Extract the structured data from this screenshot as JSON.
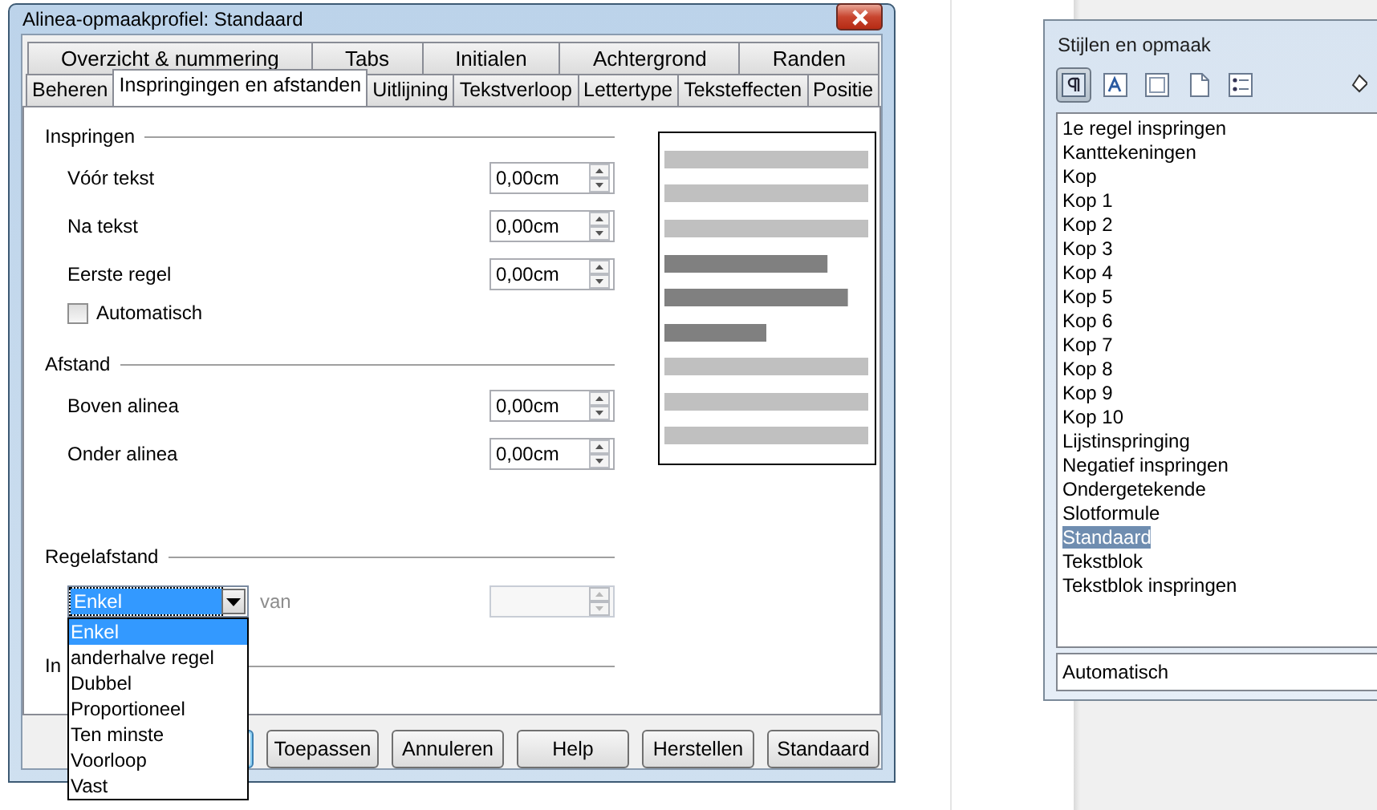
{
  "window": {
    "title": "Alinea-opmaakprofiel: Standaard"
  },
  "tab_rows": [
    [
      {
        "label": "Overzicht & nummering",
        "selected": false
      },
      {
        "label": "Tabs",
        "selected": false
      },
      {
        "label": "Initialen",
        "selected": false
      },
      {
        "label": "Achtergrond",
        "selected": false
      },
      {
        "label": "Randen",
        "selected": false
      }
    ],
    [
      {
        "label": "Beheren",
        "selected": false
      },
      {
        "label": "Inspringingen en afstanden",
        "selected": true
      },
      {
        "label": "Uitlijning",
        "selected": false
      },
      {
        "label": "Tekstverloop",
        "selected": false
      },
      {
        "label": "Lettertype",
        "selected": false
      },
      {
        "label": "Teksteffecten",
        "selected": false
      },
      {
        "label": "Positie",
        "selected": false
      }
    ]
  ],
  "sections": [
    {
      "title": "Inspringen",
      "rows": [
        {
          "kind": "spin",
          "label": "Vóór tekst",
          "value": "0,00cm"
        },
        {
          "kind": "spin",
          "label": "Na tekst",
          "value": "0,00cm"
        },
        {
          "kind": "spin",
          "label": "Eerste regel",
          "value": "0,00cm"
        },
        {
          "kind": "checkbox",
          "label": "Automatisch",
          "checked": false
        }
      ]
    },
    {
      "title": "Afstand",
      "rows": [
        {
          "kind": "spin",
          "label": "Boven alinea",
          "value": "0,00cm"
        },
        {
          "kind": "spin",
          "label": "Onder alinea",
          "value": "0,00cm"
        }
      ]
    },
    {
      "title": "Regelafstand",
      "rows": [
        {
          "kind": "combo",
          "value": "Enkel",
          "expanded": true,
          "unit_label": "van",
          "disabled": true,
          "options": [
            {
              "label": "Enkel",
              "selected": true
            },
            {
              "label": "anderhalve regel",
              "selected": false
            },
            {
              "label": "Dubbel",
              "selected": false
            },
            {
              "label": "Proportioneel",
              "selected": false
            },
            {
              "label": "Ten minste",
              "selected": false
            },
            {
              "label": "Voorloop",
              "selected": false
            },
            {
              "label": "Vast",
              "selected": false
            }
          ]
        }
      ]
    },
    {
      "title": "In"
    }
  ],
  "buttons": [
    {
      "label": "Toepassen"
    },
    {
      "label": "Annuleren"
    },
    {
      "label": "Help"
    },
    {
      "label": "Herstellen"
    },
    {
      "label": "Standaard"
    }
  ],
  "styles_panel": {
    "title": "Stijlen en opmaak",
    "items": [
      {
        "label": "1e regel inspringen",
        "selected": false
      },
      {
        "label": "Kanttekeningen",
        "selected": false
      },
      {
        "label": "Kop",
        "selected": false
      },
      {
        "label": "Kop 1",
        "selected": false
      },
      {
        "label": "Kop 2",
        "selected": false
      },
      {
        "label": "Kop 3",
        "selected": false
      },
      {
        "label": "Kop 4",
        "selected": false
      },
      {
        "label": "Kop 5",
        "selected": false
      },
      {
        "label": "Kop 6",
        "selected": false
      },
      {
        "label": "Kop 7",
        "selected": false
      },
      {
        "label": "Kop 8",
        "selected": false
      },
      {
        "label": "Kop 9",
        "selected": false
      },
      {
        "label": "Kop 10",
        "selected": false
      },
      {
        "label": "Lijstinspringing",
        "selected": false
      },
      {
        "label": "Negatief inspringen",
        "selected": false
      },
      {
        "label": "Ondergetekende",
        "selected": false
      },
      {
        "label": "Slotformule",
        "selected": false
      },
      {
        "label": "Standaard",
        "selected": true
      },
      {
        "label": "Tekstblok",
        "selected": false
      },
      {
        "label": "Tekstblok inspringen",
        "selected": false
      }
    ],
    "filter": "Automatisch"
  }
}
